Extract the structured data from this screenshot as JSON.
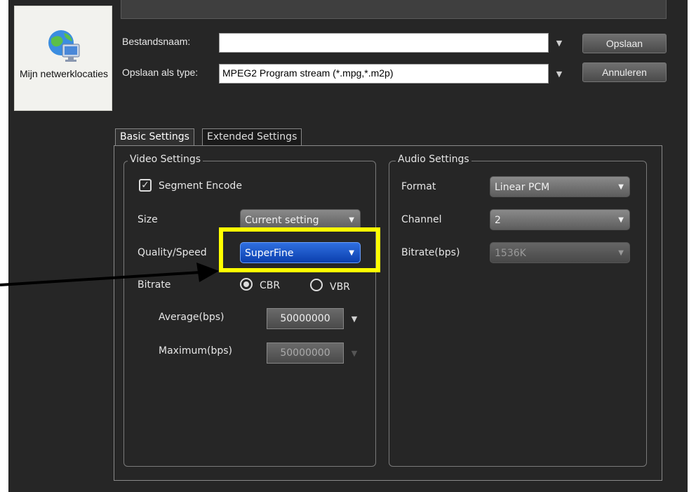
{
  "places": {
    "label": "Mijn netwerklocaties",
    "icon": "network-places-icon"
  },
  "file": {
    "filename_label": "Bestandsnaam:",
    "filename_value": "",
    "savetype_label": "Opslaan als type:",
    "savetype_value": "MPEG2 Program stream (*.mpg,*.m2p)",
    "save_button": "Opslaan",
    "cancel_button": "Annuleren"
  },
  "tabs": [
    {
      "label": "Basic Settings",
      "active": true
    },
    {
      "label": "Extended Settings",
      "active": false
    }
  ],
  "video": {
    "title": "Video Settings",
    "segment_encode": {
      "label": "Segment Encode",
      "checked": true
    },
    "size": {
      "label": "Size",
      "value": "Current setting"
    },
    "quality": {
      "label": "Quality/Speed",
      "value": "SuperFine"
    },
    "bitrate": {
      "label": "Bitrate",
      "cbr": "CBR",
      "vbr": "VBR",
      "selected": "CBR"
    },
    "average": {
      "label": "Average(bps)",
      "value": "50000000"
    },
    "maximum": {
      "label": "Maximum(bps)",
      "value": "50000000"
    }
  },
  "audio": {
    "title": "Audio Settings",
    "format": {
      "label": "Format",
      "value": "Linear PCM"
    },
    "channel": {
      "label": "Channel",
      "value": "2"
    },
    "bitrate": {
      "label": "Bitrate(bps)",
      "value": "1536K"
    }
  },
  "colors": {
    "highlight": "#ffff00",
    "arrow": "#000000",
    "selected_combo": "#0b3fae",
    "panel_bg": "#262626"
  }
}
